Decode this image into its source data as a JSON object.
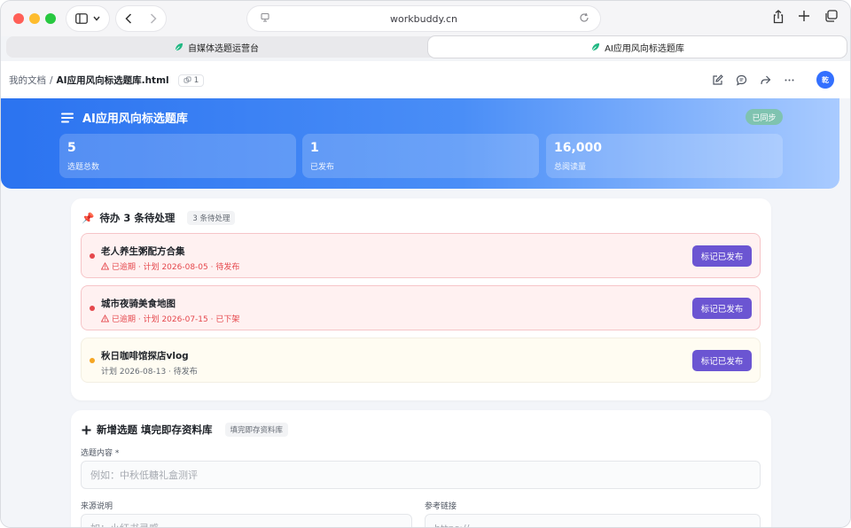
{
  "browser": {
    "url": "workbuddy.cn",
    "tabs": [
      {
        "label": "自媒体选题运营台"
      },
      {
        "label": "AI应用风向标选题库"
      }
    ]
  },
  "doc_header": {
    "breadcrumb_root": "我的文档",
    "breadcrumb_sep": "/",
    "file_name": "AI应用风向标选题库.html",
    "link_count": "1",
    "avatar_text": "乾"
  },
  "hero": {
    "title": "AI应用风向标选题库",
    "sync_label": "已同步",
    "stats": [
      {
        "value": "5",
        "label": "选题总数"
      },
      {
        "value": "1",
        "label": "已发布"
      },
      {
        "value": "16,000",
        "label": "总阅读量"
      }
    ]
  },
  "todo": {
    "icon": "📌",
    "title": "待办 3 条待处理",
    "badge": "3 条待处理",
    "items": [
      {
        "title": "老人养生粥配方合集",
        "meta": "已逾期 · 计划 2026-08-05 · 待发布",
        "status": "overdue",
        "button": "标记已发布"
      },
      {
        "title": "城市夜骑美食地图",
        "meta": "已逾期 · 计划 2026-07-15 · 已下架",
        "status": "overdue",
        "button": "标记已发布"
      },
      {
        "title": "秋日咖啡馆探店vlog",
        "meta": "计划 2026-08-13 · 待发布",
        "status": "upcoming",
        "button": "标记已发布"
      }
    ]
  },
  "form": {
    "title": "新增选题 填完即存资料库",
    "badge": "填完即存资料库",
    "topic_label": "选题内容 *",
    "topic_placeholder": "例如：中秋低糖礼盒测评",
    "source_label": "来源说明",
    "source_placeholder": "如：小红书灵感",
    "link_label": "参考链接",
    "link_placeholder": "https://"
  },
  "colors": {
    "accent": "#3370ff",
    "button": "#6b55d2",
    "overdue": "#e5484d",
    "upcoming": "#f5a623"
  }
}
